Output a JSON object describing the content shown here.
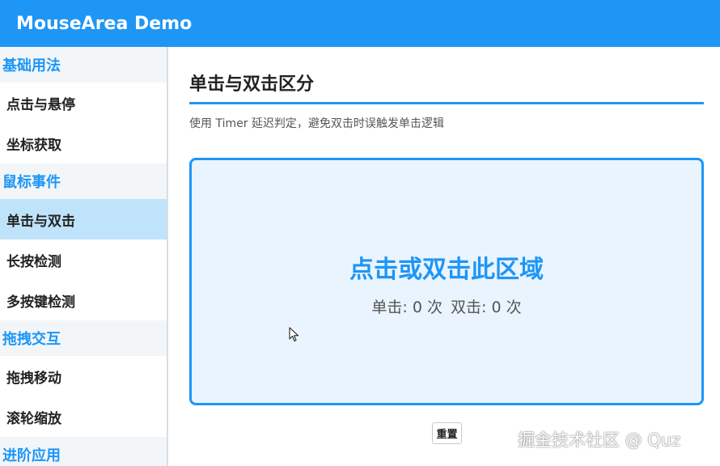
{
  "app": {
    "title": "MouseArea Demo",
    "accent": "#1e96f5"
  },
  "sidebar": {
    "sections": [
      {
        "title": "基础用法",
        "items": [
          "点击与悬停",
          "坐标获取"
        ]
      },
      {
        "title": "鼠标事件",
        "items": [
          "单击与双击",
          "长按检测",
          "多按键检测"
        ]
      },
      {
        "title": "拖拽交互",
        "items": [
          "拖拽移动",
          "滚轮缩放"
        ]
      },
      {
        "title": "进阶应用",
        "items": []
      }
    ],
    "active_item": "单击与双击"
  },
  "main": {
    "title": "单击与双击区分",
    "subtitle": "使用 Timer 延迟判定，避免双击时误触发单击逻辑",
    "area": {
      "headline": "点击或双击此区域",
      "single_label": "单击: 0 次",
      "double_label": "双击: 0 次"
    },
    "reset_label": "重置"
  },
  "watermark": "掘金技术社区 @ Quz",
  "icons": {
    "cursor": "arrow-cursor-icon"
  }
}
